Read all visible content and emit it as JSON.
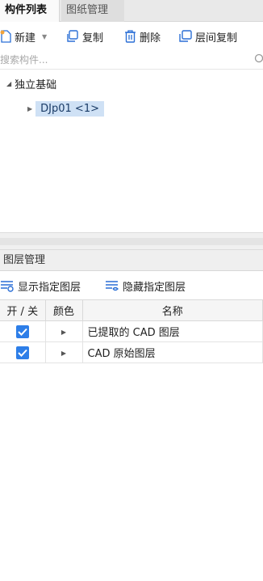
{
  "tabs": [
    {
      "label": "构件列表"
    },
    {
      "label": "图纸管理"
    }
  ],
  "toolbar": {
    "new_label": "新建",
    "copy_label": "复制",
    "delete_label": "删除",
    "floor_copy_label": "层间复制"
  },
  "search": {
    "placeholder": "搜索构件..."
  },
  "tree": {
    "root_label": "独立基础",
    "child_label": "DJp01 <1>"
  },
  "layer_panel": {
    "title": "图层管理",
    "show_label": "显示指定图层",
    "hide_label": "隐藏指定图层",
    "columns": {
      "on_off": "开 / 关",
      "color": "颜色",
      "name": "名称"
    },
    "rows": [
      {
        "checked": true,
        "name": "已提取的 CAD 图层"
      },
      {
        "checked": true,
        "name": "CAD 原始图层"
      }
    ]
  },
  "colors": {
    "accent": "#2d7ee8",
    "selection": "#cfe1f5"
  }
}
